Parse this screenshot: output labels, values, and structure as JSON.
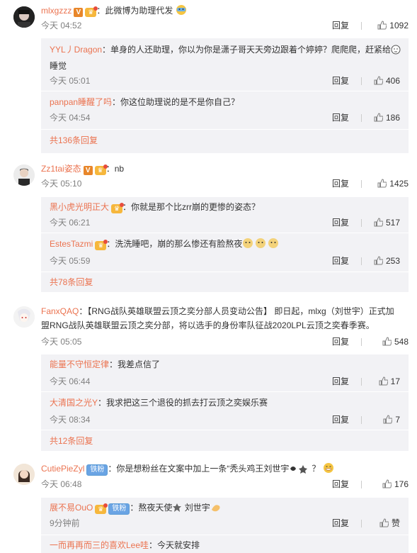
{
  "comments": [
    {
      "user": "mlxgzzz",
      "text": "：此微博为助理代发",
      "time": "今天 04:52",
      "reply": "回复",
      "likes": "1092",
      "replies": [
        {
          "user": "YYL丿Dragon",
          "text": "：单身的人还助理，你以为你是潇子哥天天旁边跟着个婷婷？爬爬爬，赶紧给",
          "text2": "睡觉",
          "time": "今天 05:01",
          "reply": "回复",
          "likes": "406"
        },
        {
          "user": "panpan睡醒了吗",
          "text": "：你这位助理说的是不是你自己？",
          "time": "今天 04:54",
          "reply": "回复",
          "likes": "186"
        }
      ],
      "more": "共136条回复"
    },
    {
      "user": "Zz1tai姿态",
      "text": "：nb",
      "time": "今天 05:10",
      "reply": "回复",
      "likes": "1425",
      "replies": [
        {
          "user": "黑小虎光明正大",
          "text": "：你就是那个比zrr崩的更惨的姿态？",
          "time": "今天 06:21",
          "reply": "回复",
          "likes": "517"
        },
        {
          "user": "EstesTazmi",
          "text": "：洗洗睡吧，崩的那么惨还有脸熬夜",
          "time": "今天 05:59",
          "reply": "回复",
          "likes": "253"
        }
      ],
      "more": "共78条回复"
    },
    {
      "user": "FanxQAQ",
      "text": "：【RNG战队英雄联盟云顶之奕分部人员变动公告】   即日起，mlxg（刘世宇）正式加",
      "text2": "盟RNG战队英雄联盟云顶之奕分部，将以选手的身份率队征战2020LPL云顶之奕春季赛。",
      "time": "今天 05:05",
      "reply": "回复",
      "likes": "548",
      "replies": [
        {
          "user": "能量不守恒定律",
          "text": "：我差点信了",
          "time": "今天 06:44",
          "reply": "回复",
          "likes": "17"
        },
        {
          "user": "大清国之光Y",
          "text": "：我求把这三个退役的抓去打云顶之奕娱乐赛",
          "time": "今天 08:34",
          "reply": "回复",
          "likes": "7"
        }
      ],
      "more": "共12条回复"
    },
    {
      "user": "CutiePieZyl",
      "fan_badge": "铁粉",
      "text": "：你是想粉丝在文案中加上一条“秃头鸡王刘世宇",
      "text_tail": "？",
      "time": "今天 06:48",
      "reply": "回复",
      "likes": "176",
      "replies": [
        {
          "user": "展不易OuO",
          "fan_badge": "铁粉",
          "text": "：熬夜天使",
          "text_tail": "刘世宇",
          "time": "9分钟前",
          "reply": "回复",
          "likes": "赞"
        },
        {
          "user": "一而再再而三的喜欢Lee哇",
          "text": "：今天就安排"
        }
      ]
    }
  ],
  "colors": {
    "accent": "#eb7350",
    "subbox": "#f2f2f5",
    "meta": "#808080"
  }
}
